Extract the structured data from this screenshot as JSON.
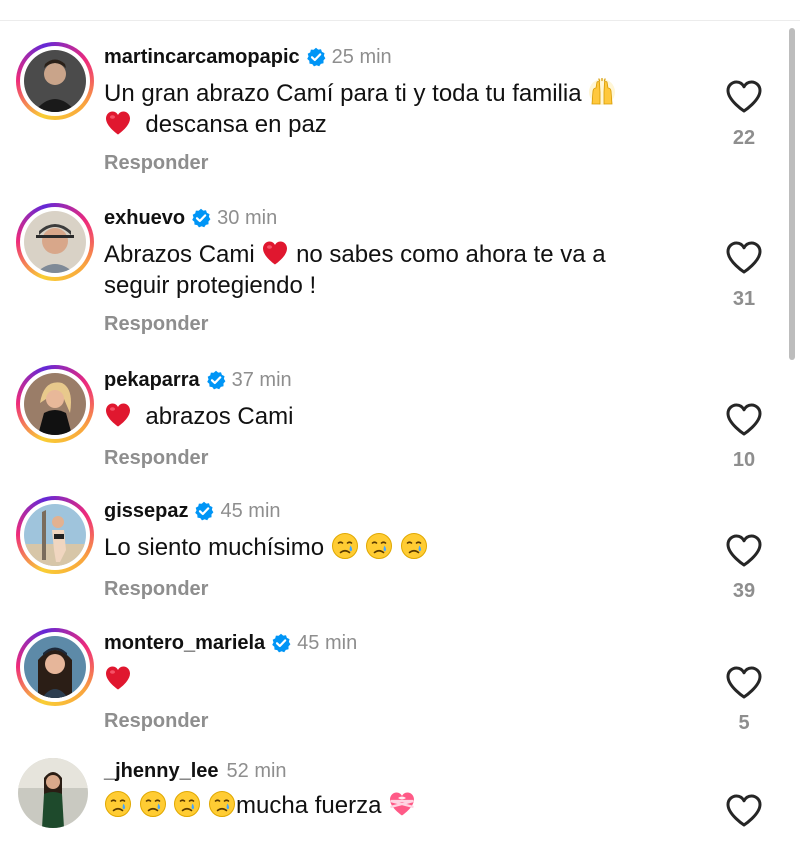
{
  "comments": [
    {
      "username": "martincarcamopapic",
      "verified": true,
      "time": "25 min",
      "text_parts": [
        "Un gran abrazo Camí para ti y toda tu familia",
        "descansa en paz"
      ],
      "emojis": [
        "raising-hands-emoji",
        "red-heart-emoji"
      ],
      "reply_label": "Responder",
      "likes": "22"
    },
    {
      "username": "exhuevo",
      "verified": true,
      "time": "30 min",
      "text_parts": [
        "Abrazos Cami",
        "no sabes como ahora te va a",
        "seguir protegiendo !"
      ],
      "emojis": [
        "red-heart-emoji"
      ],
      "reply_label": "Responder",
      "likes": "31"
    },
    {
      "username": "pekaparra",
      "verified": true,
      "time": "37 min",
      "text_parts": [
        "abrazos Cami"
      ],
      "emojis": [
        "red-heart-emoji"
      ],
      "reply_label": "Responder",
      "likes": "10"
    },
    {
      "username": "gissepaz",
      "verified": true,
      "time": "45 min",
      "text_parts": [
        "Lo siento muchísimo"
      ],
      "emojis": [
        "crying-face-emoji",
        "crying-face-emoji",
        "crying-face-emoji"
      ],
      "reply_label": "Responder",
      "likes": "39"
    },
    {
      "username": "montero_mariela",
      "verified": true,
      "time": "45 min",
      "text_parts": [],
      "emojis": [
        "red-heart-emoji"
      ],
      "reply_label": "Responder",
      "likes": "5"
    },
    {
      "username": "_jhenny_lee",
      "verified": false,
      "time": "52 min",
      "text_parts": [
        "mucha fuerza"
      ],
      "emojis": [
        "crying-face-emoji",
        "crying-face-emoji",
        "crying-face-emoji",
        "crying-face-emoji",
        "heart-with-ribbon-emoji"
      ],
      "reply_label": "",
      "likes": ""
    }
  ],
  "icons": {
    "like": "heart-outline-icon",
    "verified": "verified-badge-icon"
  },
  "colors": {
    "verified_blue": "#0095f6",
    "muted_gray": "#8e8e8e",
    "text": "#111111"
  }
}
